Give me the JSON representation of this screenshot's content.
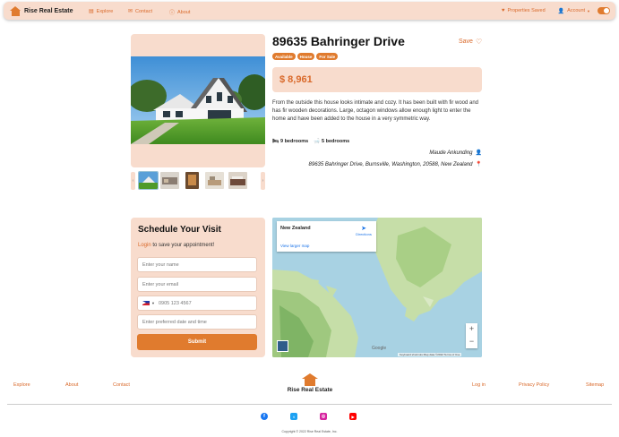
{
  "nav": {
    "brand": "Rise Real Estate",
    "explore": "Explore",
    "contact": "Contact",
    "about": "About",
    "properties_saved": "Properties Saved",
    "account": "Account"
  },
  "property": {
    "title": "89635 Bahringer Drive",
    "save_label": "Save",
    "badges": [
      "Available",
      "House",
      "For Sale"
    ],
    "price": "$ 8,961",
    "description": "From the outside this house looks intimate and cozy. It has been built with fir wood and has fir wooden decorations. Large, octagon windows allow enough light to enter the home and have been added to the house in a very symmetric way.",
    "bedrooms_a": "9 bedrooms",
    "bedrooms_b": "5 bedrooms",
    "agent": "Maude Ankunding",
    "address": "89635 Bahringer Drive, Burnsville, Washington, 20588, New Zealand"
  },
  "schedule": {
    "title": "Schedule Your Visit",
    "login": "Login",
    "sub": " to save your appointment!",
    "name_placeholder": "Enter your name",
    "email_placeholder": "Enter your email",
    "phone_value": "0905 123 4567",
    "date_placeholder": "Enter preferred date and time",
    "submit": "Submit"
  },
  "map": {
    "place": "New Zealand",
    "view_larger": "View larger map",
    "directions": "Directions",
    "footer": "Keyboard shortcuts   Map data ©2022   Terms of Use",
    "google": "Google"
  },
  "footer": {
    "explore": "Explore",
    "about": "About",
    "contact": "Contact",
    "brand": "Rise Real Estate",
    "login": "Log in",
    "privacy": "Privacy Policy",
    "sitemap": "Sitemap",
    "copyright": "Copyright © 2022 Rise Real Estate, Inc."
  },
  "colors": {
    "accent": "#e07b2e",
    "panel": "#f8dccd"
  }
}
